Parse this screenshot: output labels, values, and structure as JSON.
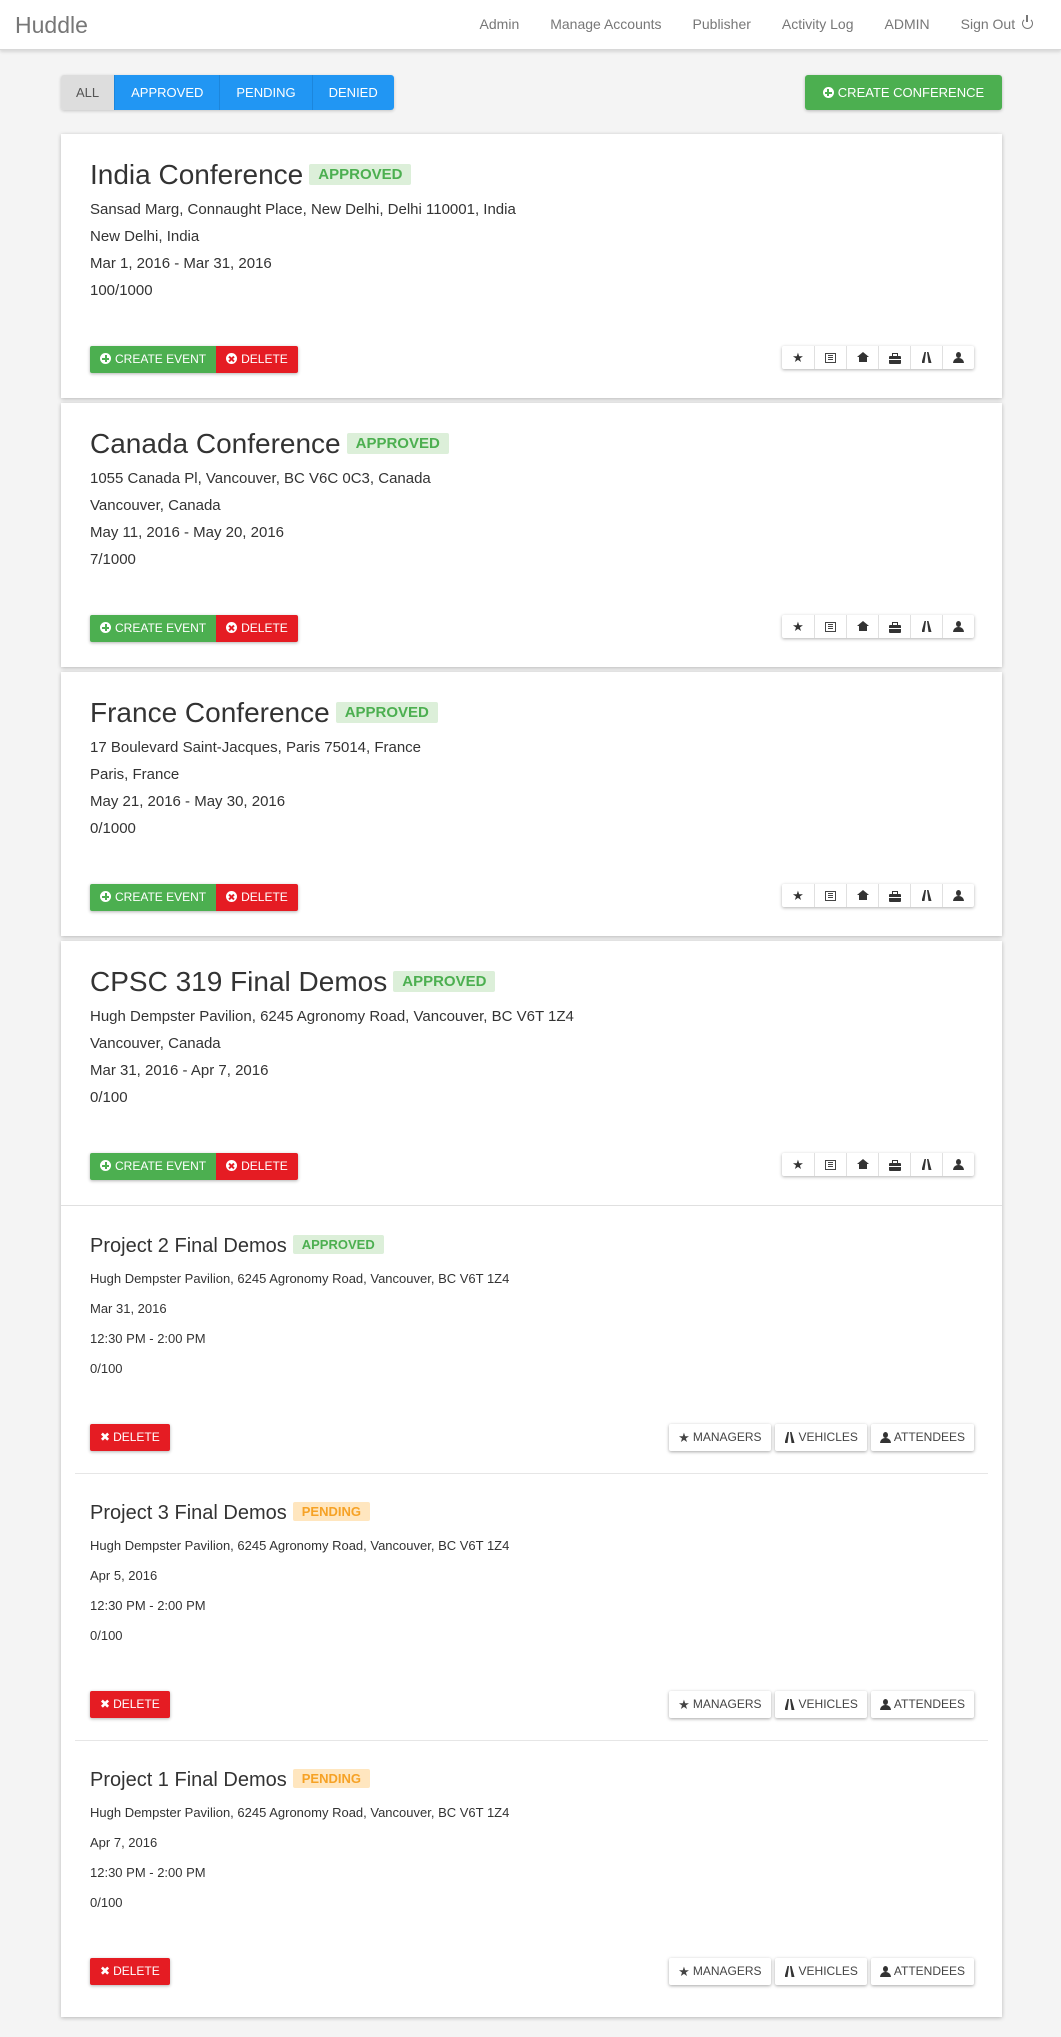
{
  "nav": {
    "brand": "Huddle",
    "links": [
      "Admin",
      "Manage Accounts",
      "Publisher",
      "Activity Log",
      "ADMIN",
      "Sign Out"
    ]
  },
  "filter": {
    "all": "ALL",
    "approved": "APPROVED",
    "pending": "PENDING",
    "denied": "DENIED"
  },
  "create_conference_label": "CREATE CONFERENCE",
  "conference_actions": {
    "create_event": "CREATE EVENT",
    "delete": "DELETE"
  },
  "event_actions": {
    "delete": "DELETE",
    "managers": "MANAGERS",
    "vehicles": "VEHICLES",
    "attendees": "ATTENDEES"
  },
  "conference_icons": [
    "star-icon",
    "table-icon",
    "home-icon",
    "briefcase-icon",
    "road-icon",
    "user-icon"
  ],
  "conferences": [
    {
      "title": "India Conference",
      "status": "APPROVED",
      "address": "Sansad Marg, Connaught Place, New Delhi, Delhi 110001, India",
      "city": "New Delhi, India",
      "dates": "Mar 1, 2016 - Mar 31, 2016",
      "capacity": "100/1000"
    },
    {
      "title": "Canada Conference",
      "status": "APPROVED",
      "address": "1055 Canada Pl, Vancouver, BC V6C 0C3, Canada",
      "city": "Vancouver, Canada",
      "dates": "May 11, 2016 - May 20, 2016",
      "capacity": "7/1000"
    },
    {
      "title": "France Conference",
      "status": "APPROVED",
      "address": "17 Boulevard Saint-Jacques, Paris 75014, France",
      "city": "Paris, France",
      "dates": "May 21, 2016 - May 30, 2016",
      "capacity": "0/1000"
    },
    {
      "title": "CPSC 319 Final Demos",
      "status": "APPROVED",
      "address": "Hugh Dempster Pavilion, 6245 Agronomy Road, Vancouver, BC V6T 1Z4",
      "city": "Vancouver, Canada",
      "dates": "Mar 31, 2016 - Apr 7, 2016",
      "capacity": "0/100"
    }
  ],
  "events": [
    {
      "title": "Project 2 Final Demos",
      "status": "APPROVED",
      "address": "Hugh Dempster Pavilion, 6245 Agronomy Road, Vancouver, BC V6T 1Z4",
      "date": "Mar 31, 2016",
      "time": "12:30 PM - 2:00 PM",
      "capacity": "0/100"
    },
    {
      "title": "Project 3 Final Demos",
      "status": "PENDING",
      "address": "Hugh Dempster Pavilion, 6245 Agronomy Road, Vancouver, BC V6T 1Z4",
      "date": "Apr 5, 2016",
      "time": "12:30 PM - 2:00 PM",
      "capacity": "0/100"
    },
    {
      "title": "Project 1 Final Demos",
      "status": "PENDING",
      "address": "Hugh Dempster Pavilion, 6245 Agronomy Road, Vancouver, BC V6T 1Z4",
      "date": "Apr 7, 2016",
      "time": "12:30 PM - 2:00 PM",
      "capacity": "0/100"
    }
  ],
  "colors": {
    "approved": "#4caf50",
    "pending": "#f6a226",
    "danger": "#e51c23",
    "primary": "#2196f3"
  }
}
